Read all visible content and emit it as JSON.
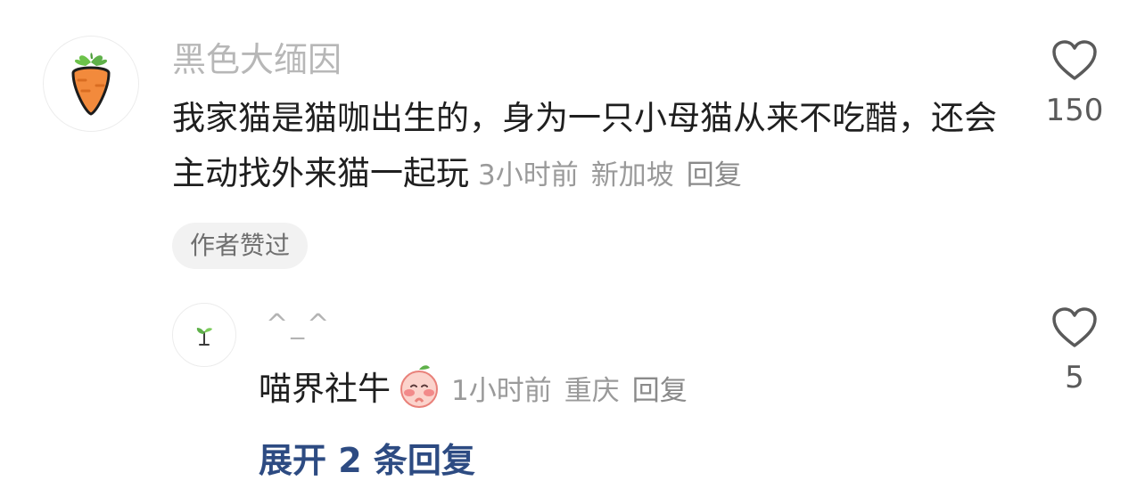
{
  "comment": {
    "username": "黑色大缅因",
    "avatar_icon": "carrot-icon",
    "text": "我家猫是猫咖出生的，身为一只小母猫从来不吃醋，还会主动找外来猫一起玩",
    "time": "3小时前",
    "location": "新加坡",
    "reply_label": "回复",
    "badge": "作者赞过",
    "like_icon": "heart-outline-icon",
    "like_count": "150"
  },
  "reply": {
    "username": "^_^",
    "avatar_icon": "sprout-icon",
    "text": "喵界社牛",
    "emoji_icon": "peach-blush-emoji-icon",
    "time": "1小时前",
    "location": "重庆",
    "reply_label": "回复",
    "like_icon": "heart-outline-icon",
    "like_count": "5"
  },
  "expand_replies": "展开 2 条回复",
  "colors": {
    "accent_link": "#2d4b82",
    "username": "#b7b7b7",
    "meta": "#9a9a9a",
    "badge_bg": "#f2f2f2",
    "carrot": "#f28a3c",
    "leaf": "#5fb14a"
  }
}
